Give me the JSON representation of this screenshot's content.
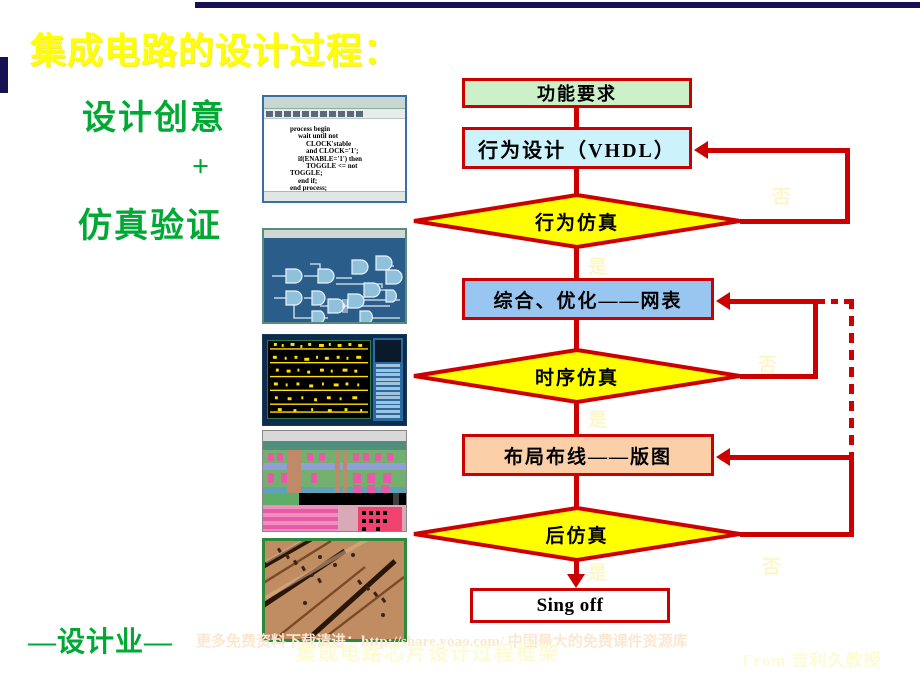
{
  "slide": {
    "title": "集成电路的设计过程：",
    "subtitle_line1": "设计创意",
    "subtitle_plus": "+",
    "subtitle_line2": "仿真验证",
    "industry_label": "—设计业—",
    "accent_navy": "#181055",
    "accent_yellow": "#ffff00",
    "accent_green": "#00a933",
    "accent_red": "#cc0000"
  },
  "watermarks": {
    "url_line": "更多免费资料下载请进：http://share.yoao.com/ 中国最大的免费课件资源库",
    "caption": "集成电路芯片设计过程框架",
    "credit": "From  吉利久教授"
  },
  "thumbnails": [
    {
      "name": "vhdl-code-editor",
      "code_lines": [
        "process begin",
        "wait until not",
        "CLOCK'stable",
        "and CLOCK='1';",
        "if(ENABLE='1') then",
        "TOGGLE <= not",
        "TOGGLE;",
        "end if;",
        "end process;"
      ]
    },
    {
      "name": "gate-schematic-viewer"
    },
    {
      "name": "timing-waveform-viewer"
    },
    {
      "name": "ic-layout-viewer"
    },
    {
      "name": "die-micrograph"
    }
  ],
  "flowchart": {
    "nodes": [
      {
        "id": "func",
        "label": "功能要求",
        "shape": "box",
        "fill": "#ccf0c8"
      },
      {
        "id": "behav",
        "label": "行为设计（VHDL）",
        "shape": "box",
        "fill": "#ccf2fb"
      },
      {
        "id": "bsim",
        "label": "行为仿真",
        "shape": "diamond",
        "fill": "#ffff00"
      },
      {
        "id": "synth",
        "label": "综合、优化——网表",
        "shape": "box",
        "fill": "#99c6f0"
      },
      {
        "id": "tsim",
        "label": "时序仿真",
        "shape": "diamond",
        "fill": "#ffff00"
      },
      {
        "id": "place",
        "label": "布局布线——版图",
        "shape": "box",
        "fill": "#fbcfa8"
      },
      {
        "id": "psim",
        "label": "后仿真",
        "shape": "diamond",
        "fill": "#ffff00"
      },
      {
        "id": "signoff",
        "label": "Sing off",
        "shape": "box",
        "fill": "#ffffff"
      }
    ],
    "branch_labels": {
      "yes": "是",
      "no": "否"
    },
    "edge_labels": [
      {
        "id": "bsim-no",
        "text": "否"
      },
      {
        "id": "bsim-yes",
        "text": "是"
      },
      {
        "id": "tsim-no",
        "text": "否"
      },
      {
        "id": "tsim-yes",
        "text": "是"
      },
      {
        "id": "psim-no",
        "text": "否"
      },
      {
        "id": "psim-yes",
        "text": "是"
      }
    ]
  }
}
